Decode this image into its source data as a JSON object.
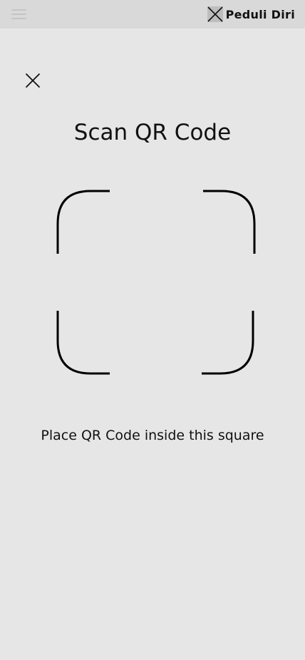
{
  "topbar": {
    "menu_icon": "hamburger-menu-icon",
    "brand": {
      "logo_icon": "x-box-logo-icon",
      "name": "Peduli Diri"
    }
  },
  "scanner": {
    "close_icon": "close-icon",
    "title": "Scan QR Code",
    "frame_icon": "qr-scan-frame",
    "instruction": "Place QR Code inside this square"
  },
  "colors": {
    "background": "#e6e6e6",
    "topbar": "#d9d9d9",
    "menu_icon": "#c4c4c4",
    "text": "#111111"
  }
}
